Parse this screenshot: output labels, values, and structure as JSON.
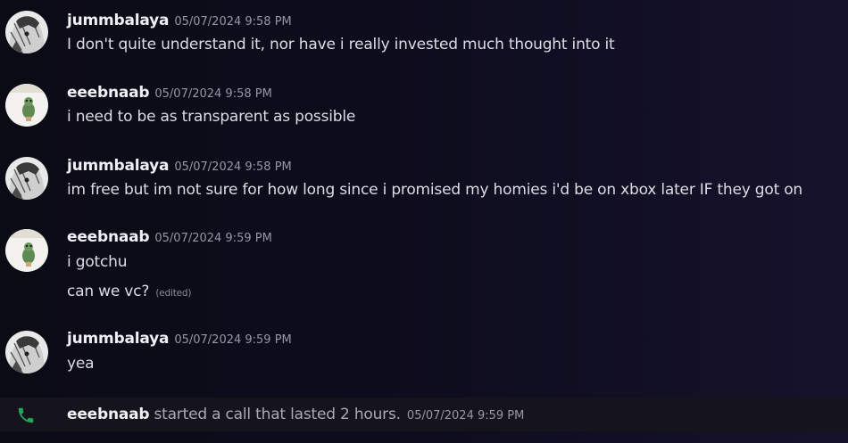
{
  "messages": [
    {
      "author": "jummbalaya",
      "timestamp": "05/07/2024 9:58 PM",
      "lines": [
        "I don't quite understand it, nor have i really invested much thought into it"
      ]
    },
    {
      "author": "eeebnaab",
      "timestamp": "05/07/2024 9:58 PM",
      "lines": [
        "i need to be as transparent as possible"
      ]
    },
    {
      "author": "jummbalaya",
      "timestamp": "05/07/2024 9:58 PM",
      "lines": [
        "im free but im not sure for how long since i promised my homies i'd be on xbox later IF they got on"
      ]
    },
    {
      "author": "eeebnaab",
      "timestamp": "05/07/2024 9:59 PM",
      "lines": [
        "i gotchu",
        "can we vc?"
      ],
      "edited_label": "(edited)"
    },
    {
      "author": "jummbalaya",
      "timestamp": "05/07/2024 9:59 PM",
      "lines": [
        "yea"
      ]
    }
  ],
  "system_message": {
    "author": "eeebnaab",
    "text": "started a call that lasted 2 hours.",
    "timestamp": "05/07/2024 9:59 PM",
    "icon": "phone-icon",
    "icon_color": "#23a55a"
  }
}
